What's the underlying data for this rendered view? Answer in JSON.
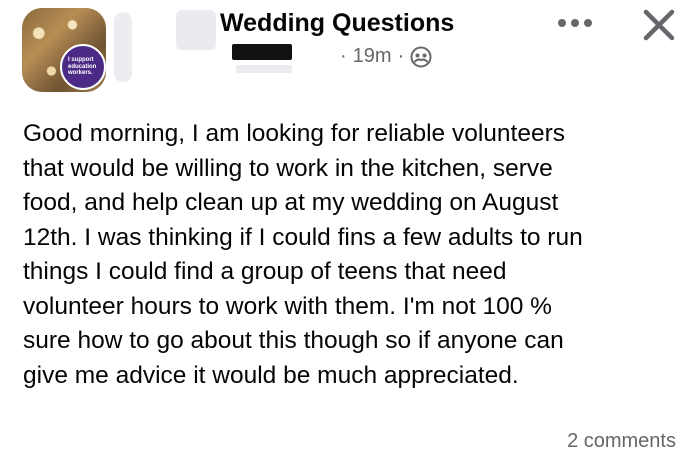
{
  "header": {
    "group_name": "Wedding Questions",
    "time": "19m",
    "separator": "·",
    "privacy_icon": "group-members-icon",
    "more_icon": "more-horizontal-icon",
    "close_icon": "close-icon",
    "avatar_badge_text": "I support education workers."
  },
  "post": {
    "body": "Good morning, I am looking for reliable volunteers\nthat would be willing to work in the kitchen, serve\nfood, and help clean up at my wedding on August\n12th. I was thinking if I could fins a few adults to run\nthings I could find a group of teens that need\nvolunteer hours to work with them. I'm not 100 %\nsure how to go about this though so if anyone can\ngive me advice it would be much appreciated."
  },
  "footer": {
    "comments_label": "2 comments"
  },
  "colors": {
    "text_primary": "#050505",
    "text_secondary": "#65676b",
    "badge_purple": "#4b2a86"
  }
}
